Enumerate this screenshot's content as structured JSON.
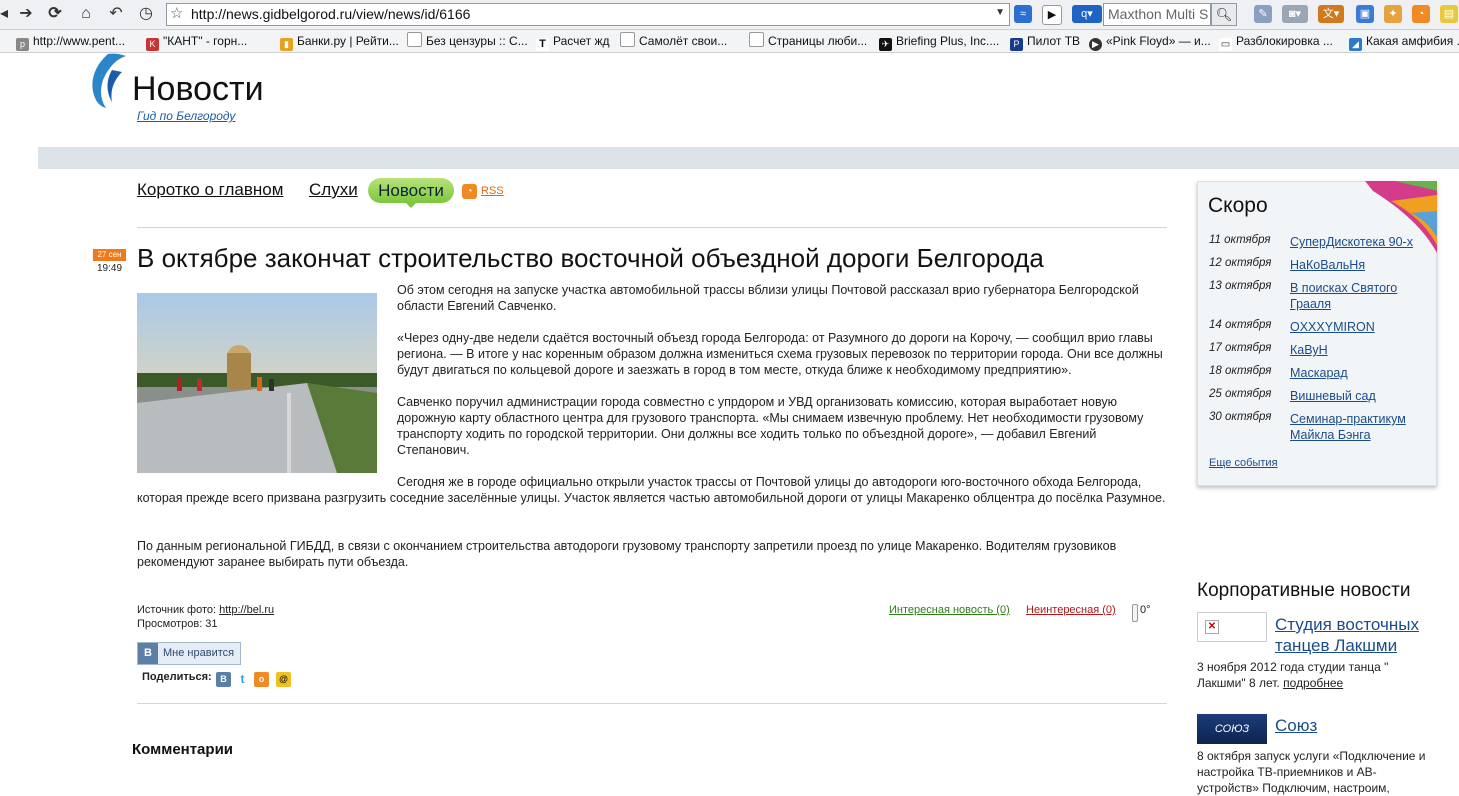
{
  "browser": {
    "url": "http://news.gidbelgorod.ru/view/news/id/6166",
    "search_placeholder": "Maxthon Multi S",
    "bookmarks": [
      "http://www.pent...",
      "\"КАНТ\" - горн...",
      "Банки.ру | Рейти...",
      "Без цензуры :: С...",
      "Расчет жд",
      "Самолёт свои...",
      "Страницы люби...",
      "Briefing Plus, Inc....",
      "Пилот ТВ",
      "«Pink Floyd» — и...",
      "Разблокировка ...",
      "Какая амфибия ..."
    ]
  },
  "site": {
    "logo_title": "Новости",
    "logo_sub": "Гид по Белгороду"
  },
  "nav": {
    "item1": "Коротко о главном",
    "item2": "Слухи",
    "item3": "Новости",
    "rss": "RSS"
  },
  "article": {
    "date": "27 сен",
    "time": "19:49",
    "headline": "В октябре закончат строительство восточной объездной дороги Белгорода",
    "p1": "Об этом сегодня на запуске участка автомобильной трассы вблизи улицы Почтовой рассказал врио губернатора Белгородской области Евгений Савченко.",
    "p2": "«Через одну-две недели сдаётся восточный объезд города Белгорода: от Разумного до дороги на Корочу, — сообщил врио главы региона. — В итоге у нас коренным образом должна измениться схема грузовых перевозок по территории города. Они все должны будут двигаться по кольцевой дороге и заезжать в город в том месте, откуда ближе к необходимому предприятию».",
    "p3": "Савченко поручил администрации города совместно с упрдором и УВД организовать комиссию, которая выработает новую дорожную карту областного центра для грузового транспорта. «Мы снимаем извечную проблему. Нет необходимости грузовому транспорту ходить по городской территории. Они должны все ходить только по объездной дороге», — добавил Евгений Степанович.",
    "p4": "Сегодня же в городе официально открыли участок трассы от Почтовой улицы до автодороги юго-восточного обхода Белгорода, которая прежде всего призвана разгрузить соседние заселённые улицы. Участок является частью автомобильной дороги от улицы Макаренко облцентра до посёлка Разумное.",
    "p5": "По данным региональной ГИБДД, в связи с окончанием строительства автодороги грузовому транспорту запретили проезд по улице Макаренко. Водителям грузовиков рекомендуют заранее выбирать пути объезда.",
    "photo_source_label": "Источник фото: ",
    "photo_source_link": "http://bel.ru",
    "views": "Просмотров: 31",
    "vote_yes": "Интересная новость (0)",
    "vote_no": "Неинтересная (0)",
    "temperature": "0°",
    "vk_like": "Мне нравится",
    "share_label": "Поделиться:",
    "comments_title": "Комментарии"
  },
  "soon": {
    "title": "Скоро",
    "events": [
      {
        "date": "11 октября",
        "name": "СуперДискотека 90-х"
      },
      {
        "date": "12 октября",
        "name": "НаКоВальНя"
      },
      {
        "date": "13 октября",
        "name": "В поисках Святого Грааля"
      },
      {
        "date": "14 октября",
        "name": "OXXXYMIRON"
      },
      {
        "date": "17 октября",
        "name": "КаВуН"
      },
      {
        "date": "18 октября",
        "name": "Маскарад"
      },
      {
        "date": "25 октября",
        "name": "Вишневый сад"
      },
      {
        "date": "30 октября",
        "name": "Семинар-практикум Майкла Бэнга"
      }
    ],
    "more": "Еще события"
  },
  "corporate": {
    "title": "Корпоративные новости",
    "item1_title": "Студия восточных танцев Лакшми",
    "item1_desc": "3 ноября 2012 года студии танца \" Лакшми\" 8 лет.",
    "item1_more": "подробнее",
    "item2_logo": "СОЮЗ",
    "item2_title": "Союз",
    "item2_desc": "8 октября запуск услуги «Подключение и настройка ТВ-приемников и АВ-устройств» Подключим, настроим,"
  }
}
